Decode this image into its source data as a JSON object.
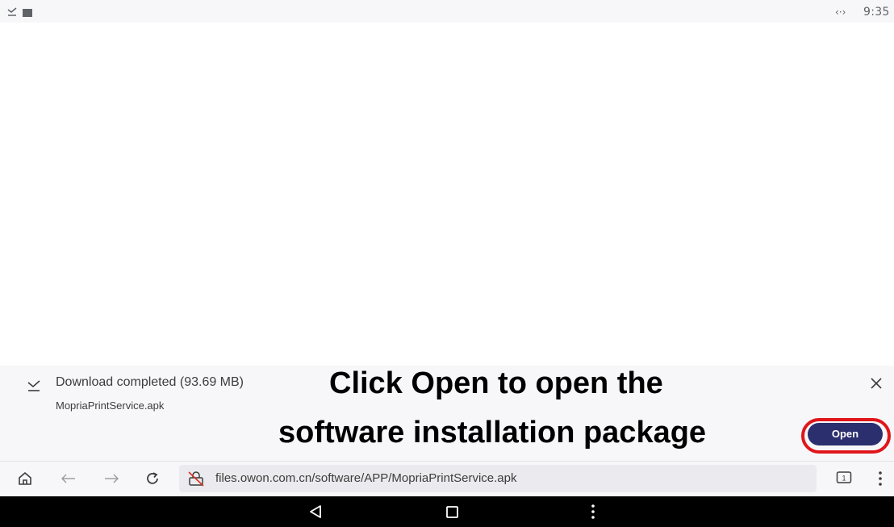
{
  "status_bar": {
    "time": "9:35",
    "arrows_glyph": "‹·›",
    "icons": [
      "download-done-icon",
      "notification-square-icon",
      "data-arrows-icon"
    ]
  },
  "download": {
    "title": "Download completed (93.69 MB)",
    "filename": "MopriaPrintService.apk",
    "open_label": "Open",
    "close_icon": "close-icon"
  },
  "annotation": {
    "line1": "Click Open to open the",
    "line2": "software installation package",
    "highlight_color": "#e0161b"
  },
  "toolbar": {
    "url": "files.owon.com.cn/software/APP/MopriaPrintService.apk",
    "tab_count": "1",
    "icons": [
      "home-icon",
      "back-arrow-icon",
      "forward-arrow-icon",
      "reload-icon",
      "insecure-lock-icon",
      "tabs-icon",
      "overflow-menu-icon"
    ]
  },
  "nav_bar": {
    "icons": [
      "back-triangle-icon",
      "home-square-icon",
      "menu-dots-icon"
    ]
  },
  "colors": {
    "accent": "#2b2f6e",
    "panel_bg": "#f7f7f9",
    "annotation_ring": "#e0161b"
  }
}
